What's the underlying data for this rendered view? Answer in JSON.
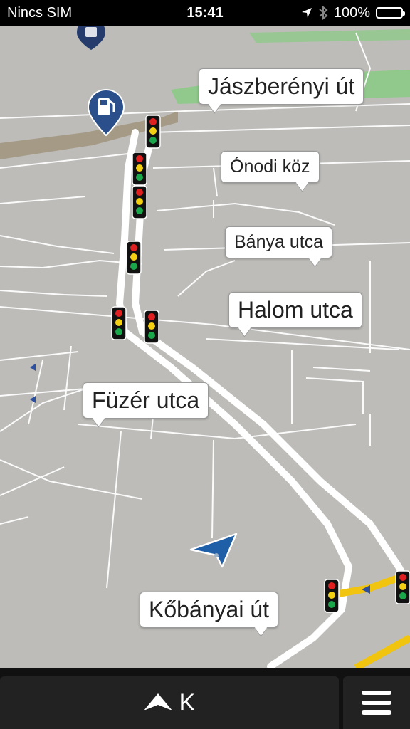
{
  "status_bar": {
    "carrier": "Nincs SIM",
    "time": "15:41",
    "battery": "100%",
    "icons": [
      "location-arrow-icon",
      "bluetooth-icon",
      "battery-icon"
    ]
  },
  "map": {
    "street_labels": [
      "Jászberényi út",
      "Ónodi köz",
      "Bánya utca",
      "Halom utca",
      "Füzér utca",
      "Kőbányai út"
    ],
    "pois": [
      "fuel-station-icon",
      "poi-pin-icon"
    ],
    "colors": {
      "background": "#bdbcb8",
      "road": "#ffffff",
      "main_road": "#f1c40f",
      "park": "#7fcf7a",
      "position_marker": "#1f5fa8"
    }
  },
  "bottom_bar": {
    "heading": "K",
    "icons": [
      "direction-arrow-icon",
      "hamburger-menu-icon"
    ]
  }
}
